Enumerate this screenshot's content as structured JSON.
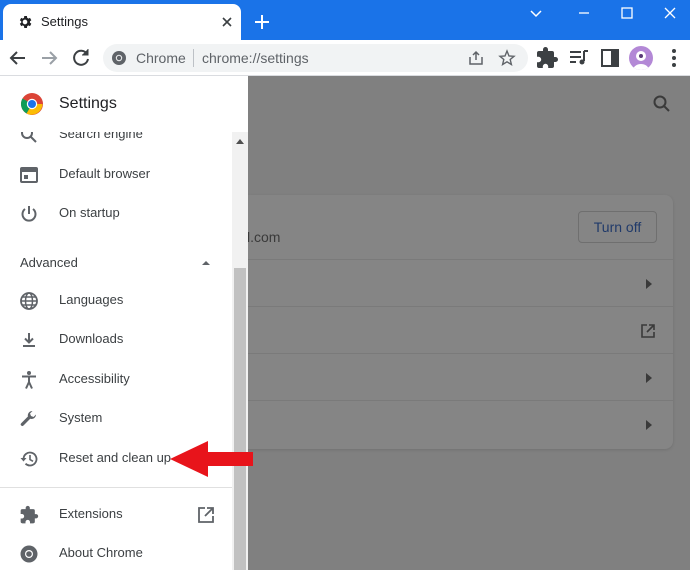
{
  "browser": {
    "tab_title": "Settings",
    "omnibox": {
      "site_label": "Chrome",
      "url": "chrome://settings"
    }
  },
  "sidebar": {
    "title": "Settings",
    "items_top": [
      {
        "label": "Search engine",
        "icon": "search-icon"
      },
      {
        "label": "Default browser",
        "icon": "browser-icon"
      },
      {
        "label": "On startup",
        "icon": "power-icon"
      }
    ],
    "advanced_label": "Advanced",
    "items_advanced": [
      {
        "label": "Languages",
        "icon": "globe-icon"
      },
      {
        "label": "Downloads",
        "icon": "download-icon"
      },
      {
        "label": "Accessibility",
        "icon": "accessibility-icon"
      },
      {
        "label": "System",
        "icon": "wrench-icon"
      },
      {
        "label": "Reset and clean up",
        "icon": "history-reset-icon"
      }
    ],
    "items_bottom": [
      {
        "label": "Extensions",
        "icon": "puzzle-icon"
      },
      {
        "label": "About Chrome",
        "icon": "chrome-icon"
      }
    ]
  },
  "main": {
    "account_email_fragment": "l.com",
    "turn_off_label": "Turn off"
  },
  "colors": {
    "accent": "#1a73e8",
    "overlay": "#808080",
    "arrow": "#e8141b"
  }
}
